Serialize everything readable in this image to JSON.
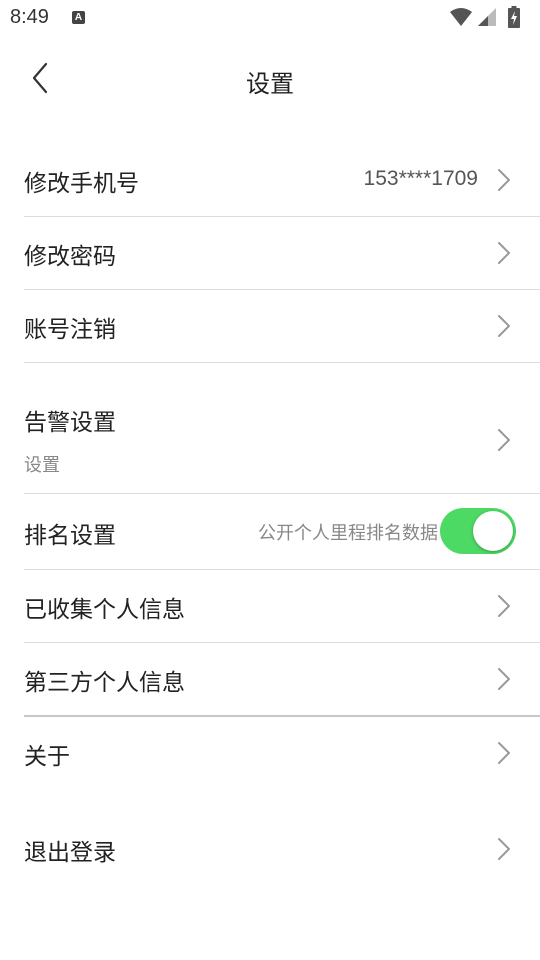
{
  "status_bar": {
    "time": "8:49",
    "notification_icon": "A"
  },
  "toolbar": {
    "title": "设置",
    "back_icon": "chevron-left-icon"
  },
  "settings": {
    "change_phone": {
      "label": "修改手机号",
      "value": "153****1709"
    },
    "change_password": {
      "label": "修改密码"
    },
    "delete_account": {
      "label": "账号注销"
    },
    "alarm_settings": {
      "label": "告警设置",
      "sub": "设置"
    },
    "ranking_settings": {
      "label": "排名设置",
      "hint": "公开个人里程排名数据",
      "enabled": true
    },
    "collected_info": {
      "label": "已收集个人信息"
    },
    "third_party_info": {
      "label": "第三方个人信息"
    },
    "about": {
      "label": "关于"
    },
    "logout": {
      "label": "退出登录"
    }
  },
  "colors": {
    "toggle_on": "#4cd964",
    "divider": "#dcdcdc",
    "text_primary": "#222222",
    "text_secondary": "#888888"
  }
}
